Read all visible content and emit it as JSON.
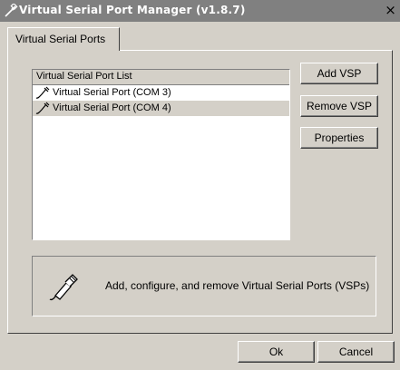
{
  "window": {
    "title": "Virtual Serial Port Manager (v1.8.7)",
    "close_label": "×"
  },
  "tabs": [
    {
      "label": "Virtual Serial Ports",
      "active": true
    }
  ],
  "list": {
    "header": "Virtual Serial Port List",
    "items": [
      {
        "label": "Virtual Serial Port (COM 3)",
        "icon": "cable-plug-icon",
        "selected": false
      },
      {
        "label": "Virtual Serial Port (COM 4)",
        "icon": "cable-plug-icon",
        "selected": true
      }
    ]
  },
  "buttons": {
    "add": "Add VSP",
    "remove": "Remove VSP",
    "properties": "Properties",
    "ok": "Ok",
    "cancel": "Cancel"
  },
  "info": {
    "icon": "serial-cable-icon",
    "text": "Add, configure, and remove Virtual Serial Ports (VSPs)"
  },
  "colors": {
    "face": "#d4d0c8",
    "titlebar": "#808080",
    "list_background": "#ffffff"
  }
}
